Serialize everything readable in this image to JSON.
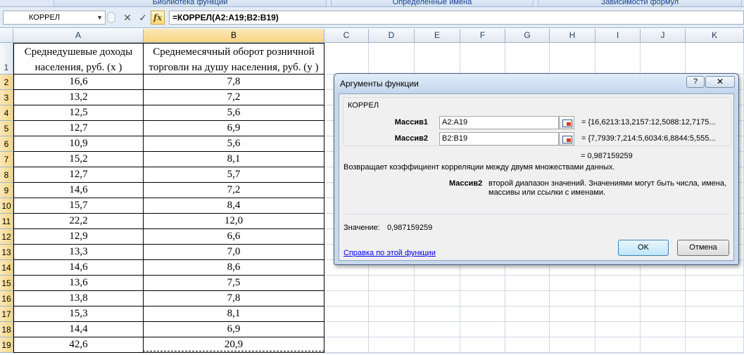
{
  "ribbon": {
    "groups": [
      "Библиотека функций",
      "Определенные имена",
      "Зависимости формул"
    ]
  },
  "formula_bar": {
    "name_box": "КОРРЕЛ",
    "fx_label": "fx",
    "formula": "=КОРРЕЛ(A2:A19;B2:B19)"
  },
  "sheet": {
    "columns": [
      "A",
      "B",
      "C",
      "D",
      "E",
      "F",
      "G",
      "H",
      "I",
      "J",
      "K"
    ],
    "rows": [
      "1",
      "2",
      "3",
      "4",
      "5",
      "6",
      "7",
      "8",
      "9",
      "10",
      "11",
      "12",
      "13",
      "14",
      "15",
      "16",
      "17",
      "18",
      "19"
    ],
    "header_a_line1": "Среднедушевые доходы",
    "header_a_line2": "населения, руб. (x )",
    "header_b_line1": "Среднемесячный оборот розничной",
    "header_b_line2": "торговли на душу населения, руб. (y )",
    "col_a": [
      "16,6",
      "13,2",
      "12,5",
      "12,7",
      "10,9",
      "15,2",
      "12,7",
      "14,6",
      "15,7",
      "22,2",
      "12,9",
      "13,3",
      "14,6",
      "13,6",
      "13,8",
      "15,3",
      "14,4",
      "42,6"
    ],
    "col_b": [
      "7,8",
      "7,2",
      "5,6",
      "6,9",
      "5,6",
      "8,1",
      "5,7",
      "7,2",
      "8,4",
      "12,0",
      "6,6",
      "7,0",
      "8,6",
      "7,5",
      "7,8",
      "8,1",
      "6,9",
      "20,9"
    ]
  },
  "dialog": {
    "title": "Аргументы функции",
    "help_label": "?",
    "close_label": "✕",
    "function_name": "КОРРЕЛ",
    "arg1_label": "Массив1",
    "arg1_value": "A2:A19",
    "arg1_result": "=  {16,6213:13,2157:12,5088:12,7175...",
    "arg2_label": "Массив2",
    "arg2_value": "B2:B19",
    "arg2_result": "=  {7,7939:7,214:5,6034:6,8844:5,555...",
    "function_result": "=  0,987159259",
    "description": "Возвращает коэффициент корреляции между двумя множествами данных.",
    "arg_help_name": "Массив2",
    "arg_help_text_line1": "второй диапазон значений. Значениями могут быть числа, имена,",
    "arg_help_text_line2": "массивы или ссылки с именами.",
    "value_label": "Значение:",
    "value": "0,987159259",
    "help_link": "Справка по этой функции",
    "ok_label": "OK",
    "cancel_label": "Отмена"
  },
  "colors": {
    "selected_header": "#f8d581",
    "grid_line": "#d0d7e5",
    "dialog_frame": "#c8d9ee",
    "link": "#0000ee"
  }
}
